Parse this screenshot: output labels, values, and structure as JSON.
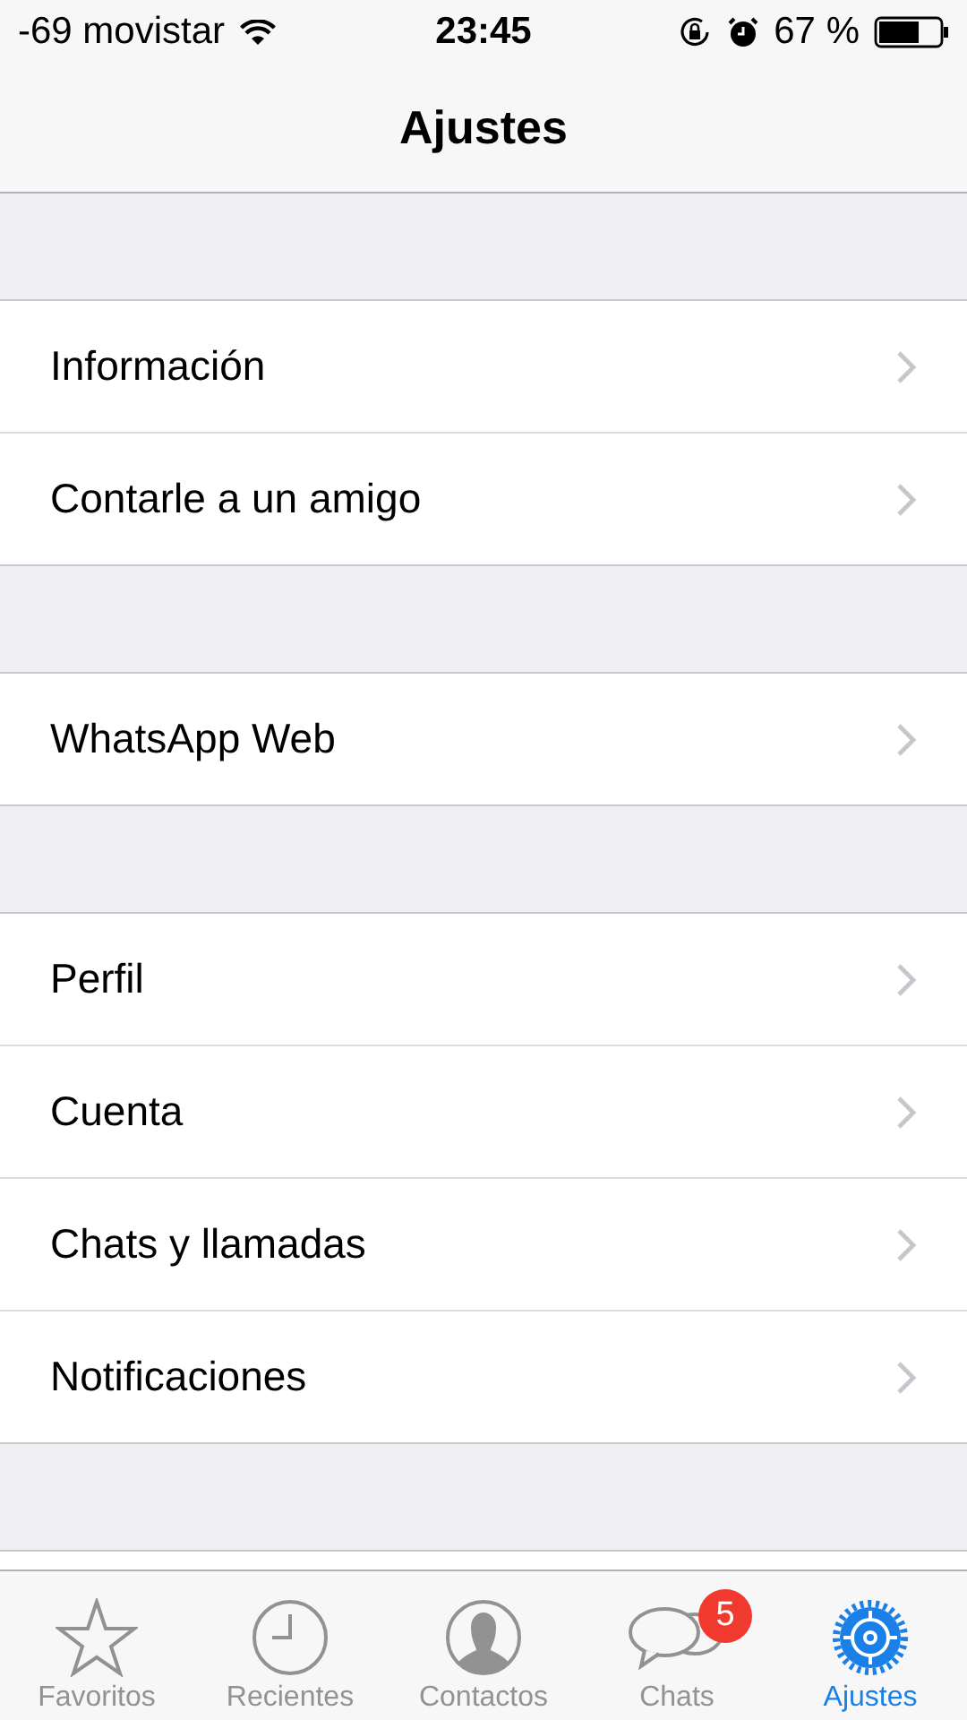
{
  "status_bar": {
    "carrier": "-69 movistar",
    "time": "23:45",
    "battery_percent": "67 %"
  },
  "nav": {
    "title": "Ajustes"
  },
  "groups": [
    {
      "items": [
        "Información",
        "Contarle a un amigo"
      ]
    },
    {
      "items": [
        "WhatsApp Web"
      ]
    },
    {
      "items": [
        "Perfil",
        "Cuenta",
        "Chats y llamadas",
        "Notificaciones"
      ]
    }
  ],
  "tabs": [
    {
      "kind": "star",
      "label": "Favoritos",
      "selected": false
    },
    {
      "kind": "clock",
      "label": "Recientes",
      "selected": false
    },
    {
      "kind": "person",
      "label": "Contactos",
      "selected": false
    },
    {
      "kind": "chats",
      "label": "Chats",
      "selected": false,
      "badge": "5"
    },
    {
      "kind": "gear",
      "label": "Ajustes",
      "selected": true
    }
  ]
}
